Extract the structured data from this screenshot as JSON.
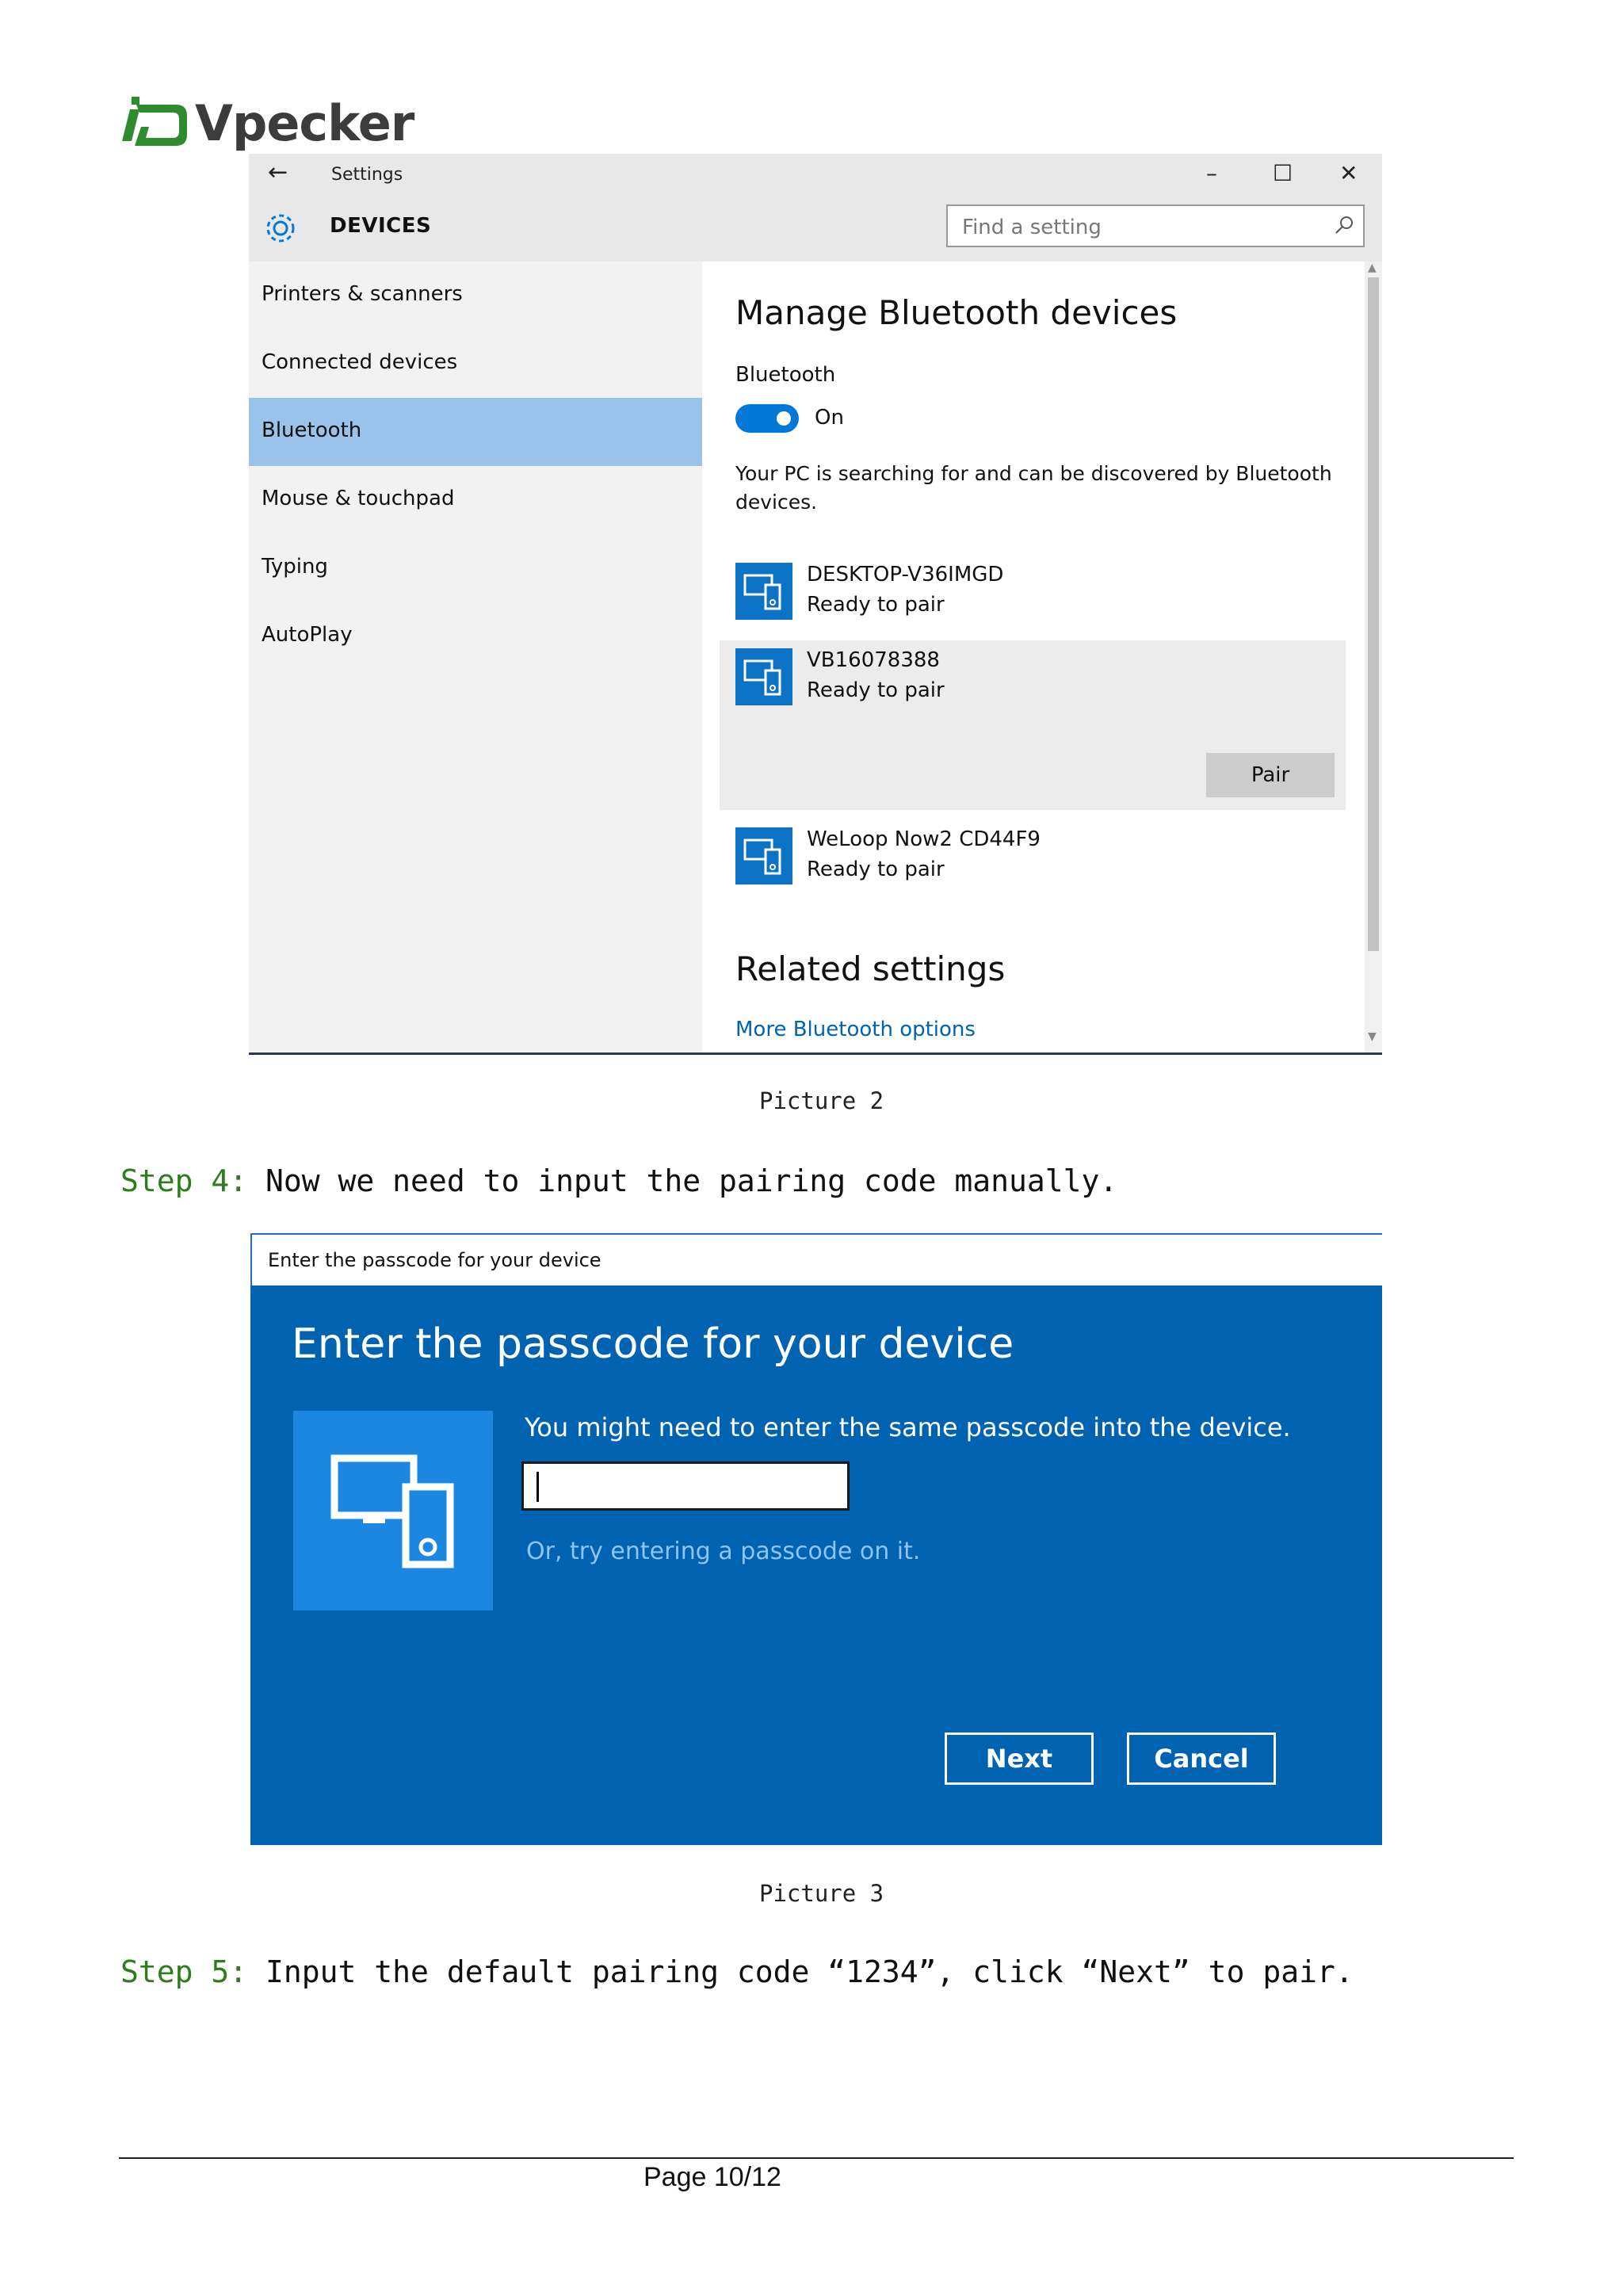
{
  "brand": {
    "name": "Vpecker",
    "green": "#2e8b2e"
  },
  "picture2": {
    "window_title": "Settings",
    "header_title": "DEVICES",
    "search_placeholder": "Find a setting",
    "sidebar": [
      {
        "label": "Printers & scanners",
        "selected": false
      },
      {
        "label": "Connected devices",
        "selected": false
      },
      {
        "label": "Bluetooth",
        "selected": true
      },
      {
        "label": "Mouse & touchpad",
        "selected": false
      },
      {
        "label": "Typing",
        "selected": false
      },
      {
        "label": "AutoPlay",
        "selected": false
      }
    ],
    "main": {
      "heading": "Manage Bluetooth devices",
      "bluetooth_label": "Bluetooth",
      "toggle_state": "On",
      "description": "Your PC is searching for and can be discovered by Bluetooth devices.",
      "devices": [
        {
          "name": "DESKTOP-V36IMGD",
          "status": "Ready to pair"
        },
        {
          "name": "VB16078388",
          "status": "Ready to pair",
          "action": "Pair"
        },
        {
          "name": "WeLoop Now2 CD44F9",
          "status": "Ready to pair"
        }
      ],
      "related_heading": "Related settings",
      "link": "More Bluetooth options"
    },
    "caption": "Picture 2"
  },
  "step4": {
    "label": "Step 4:",
    "text": " Now we need to input the pairing code manually."
  },
  "picture3": {
    "window_title": "Enter the passcode for your device",
    "title": "Enter the passcode for your device",
    "message": "You might need to enter the same passcode into the device.",
    "hint": "Or, try entering a passcode on it.",
    "next_label": "Next",
    "cancel_label": "Cancel",
    "caption": "Picture 3"
  },
  "step5": {
    "label": "Step 5:",
    "text": " Input the default pairing code “1234”, click “Next” to pair."
  },
  "footer": {
    "page": "Page 10/12"
  },
  "colors": {
    "accent_blue": "#0063b1",
    "selection": "#99c3ea",
    "step_green": "#2e7d1c"
  }
}
